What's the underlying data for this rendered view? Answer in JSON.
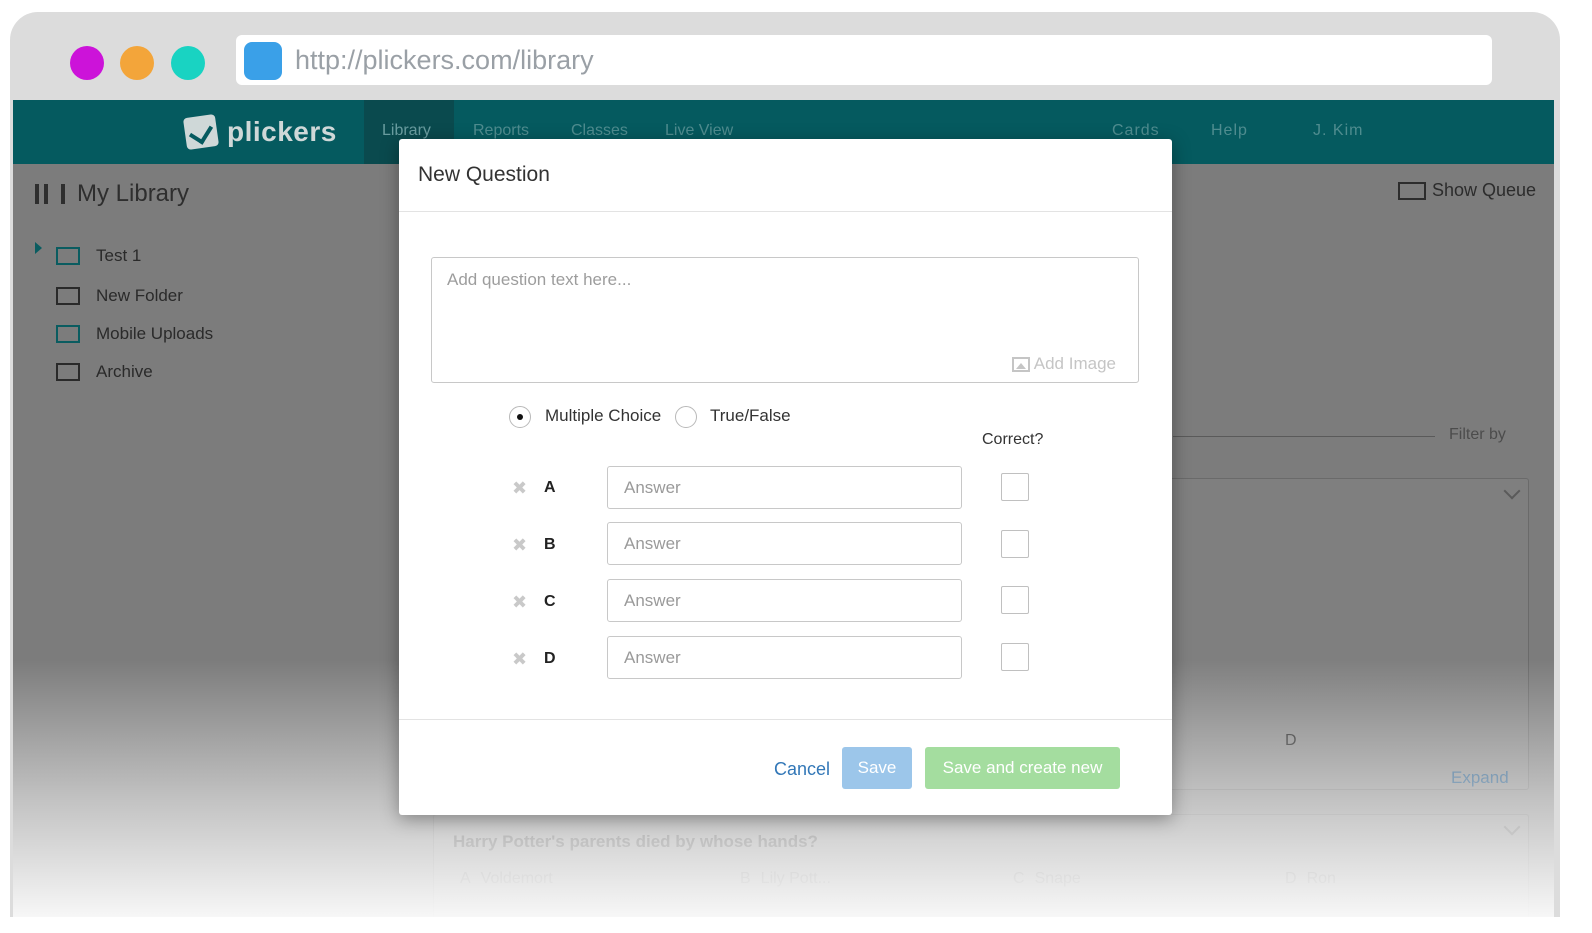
{
  "browser": {
    "url": "http://plickers.com/library",
    "dot_colors": [
      "#cc13d9",
      "#f3a53a",
      "#19d3c2"
    ]
  },
  "nav": {
    "logo": "plickers",
    "tabs": [
      "Library",
      "Reports",
      "Classes",
      "Live View"
    ],
    "active_tab": "Library",
    "right": {
      "cards": "Cards",
      "help": "Help",
      "user": "J. Kim"
    },
    "bar_color": "#055a5f"
  },
  "sidebar": {
    "title": "My Library",
    "items": [
      {
        "label": "Test 1",
        "icon": "folder-icon"
      },
      {
        "label": "New Folder",
        "icon": "new-folder-icon"
      },
      {
        "label": "Mobile Uploads",
        "icon": "mobile-upload-icon"
      },
      {
        "label": "Archive",
        "icon": "archive-icon"
      }
    ]
  },
  "main": {
    "show_queue": "Show Queue",
    "filter_by": "Filter by",
    "card1_answer_d": "D",
    "expand": "Expand",
    "card2_question": "Harry Potter's parents died by whose hands?",
    "card2_answers": [
      {
        "letter": "A",
        "text": "Voldemort"
      },
      {
        "letter": "B",
        "text": "Lily Pott..."
      },
      {
        "letter": "C",
        "text": "Snape"
      },
      {
        "letter": "D",
        "text": "Ron"
      }
    ]
  },
  "modal": {
    "title": "New Question",
    "question_placeholder": "Add question text here...",
    "add_image": "Add Image",
    "type_options": [
      {
        "label": "Multiple Choice",
        "selected": true
      },
      {
        "label": "True/False",
        "selected": false
      }
    ],
    "correct_header": "Correct?",
    "answers": [
      {
        "letter": "A",
        "placeholder": "Answer",
        "correct": false
      },
      {
        "letter": "B",
        "placeholder": "Answer",
        "correct": false
      },
      {
        "letter": "C",
        "placeholder": "Answer",
        "correct": false
      },
      {
        "letter": "D",
        "placeholder": "Answer",
        "correct": false
      }
    ],
    "buttons": {
      "cancel": "Cancel",
      "save": "Save",
      "save_new": "Save and create new"
    },
    "colors": {
      "save": "#9cc6ea",
      "save_new": "#a4dd9f",
      "cancel": "#3277b7"
    }
  }
}
